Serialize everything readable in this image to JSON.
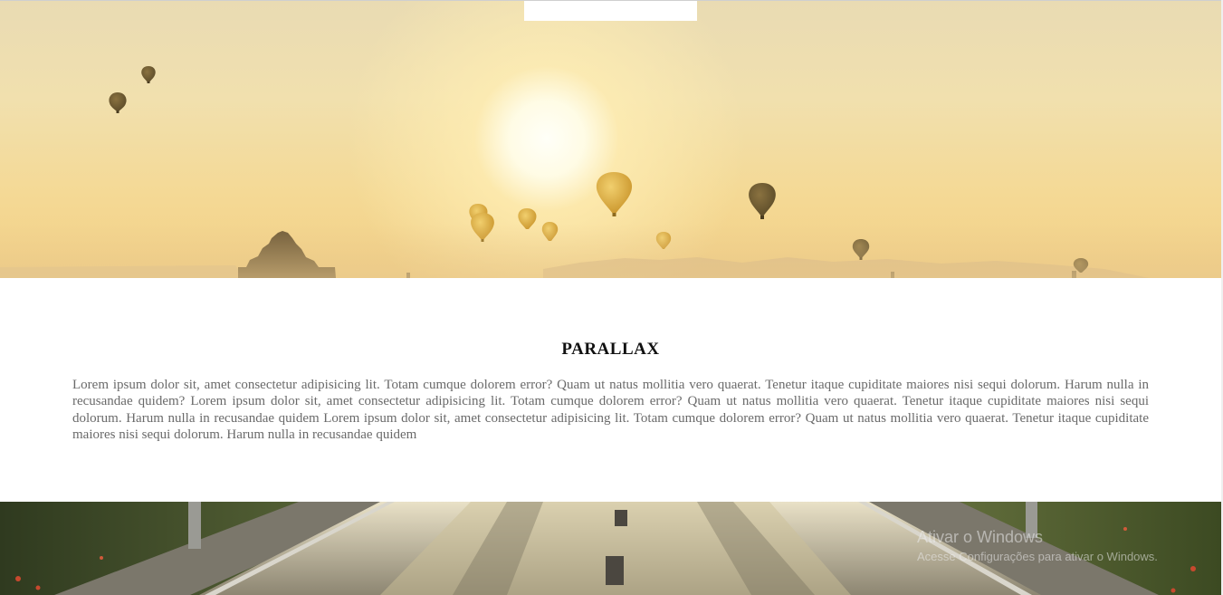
{
  "hero": {
    "image": "hot-air-balloons-sunset-image"
  },
  "content": {
    "title": "PARALLAX",
    "paragraph": "Lorem ipsum dolor sit, amet consectetur adipisicing lit. Totam cumque dolorem error? Quam ut natus mollitia vero quaerat. Tenetur itaque cupiditate maiores nisi sequi dolorum. Harum nulla in recusandae quidem? Lorem ipsum dolor sit, amet consectetur adipisicing lit. Totam cumque dolorem error? Quam ut natus mollitia vero quaerat. Tenetur itaque cupiditate maiores nisi sequi dolorum. Harum nulla in recusandae quidem Lorem ipsum dolor sit, amet consectetur adipisicing lit. Totam cumque dolorem error? Quam ut natus mollitia vero quaerat. Tenetur itaque cupiditate maiores nisi sequi dolorum. Harum nulla in recusandae quidem"
  },
  "road": {
    "image": "road-landscape-image"
  },
  "watermark": {
    "title": "Ativar o Windows",
    "subtitle": "Acesse Configurações para ativar o Windows."
  },
  "colors": {
    "title": "#111111",
    "paragraph": "#6a6a6a",
    "sky": "#f1e0ae",
    "balloon_dark": "#6b5a35",
    "balloon_gold": "#d9a93a"
  }
}
